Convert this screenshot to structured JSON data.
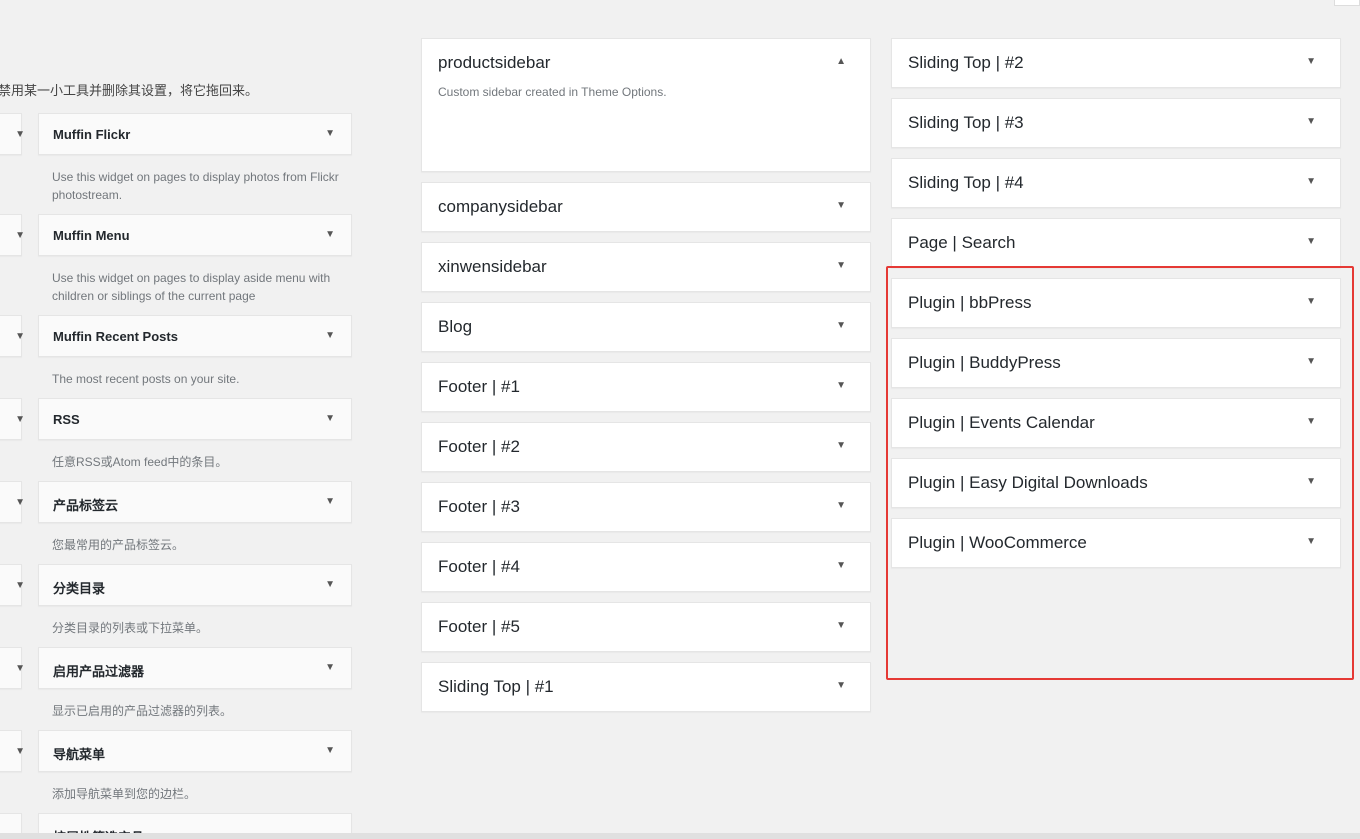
{
  "intro": "禁用某一小工具并删除其设置，将它拖回来。",
  "available_widgets": [
    {
      "title": "Muffin Flickr",
      "desc": "Use this widget on pages to display photos from Flickr photostream."
    },
    {
      "title": "Muffin Menu",
      "desc": "Use this widget on pages to display aside menu with children or siblings of the current page"
    },
    {
      "title": "Muffin Recent Posts",
      "desc": "The most recent posts on your site."
    },
    {
      "title": "RSS",
      "desc": "任意RSS或Atom feed中的条目。"
    },
    {
      "title": "产品标签云",
      "desc": "您最常用的产品标签云。"
    },
    {
      "title": "分类目录",
      "desc": "分类目录的列表或下拉菜单。"
    },
    {
      "title": "启用产品过滤器",
      "desc": "显示已启用的产品过滤器的列表。"
    },
    {
      "title": "导航菜单",
      "desc": "添加导航菜单到您的边栏。"
    },
    {
      "title": "按属性筛选产品",
      "desc": ""
    }
  ],
  "sidebars_middle": [
    {
      "title": "productsidebar",
      "desc": "Custom sidebar created in Theme Options.",
      "arrow": "▲"
    },
    {
      "title": "companysidebar",
      "arrow": "▼"
    },
    {
      "title": "xinwensidebar",
      "arrow": "▼"
    },
    {
      "title": "Blog",
      "arrow": "▼"
    },
    {
      "title": "Footer | #1",
      "arrow": "▼"
    },
    {
      "title": "Footer | #2",
      "arrow": "▼"
    },
    {
      "title": "Footer | #3",
      "arrow": "▼"
    },
    {
      "title": "Footer | #4",
      "arrow": "▼"
    },
    {
      "title": "Footer | #5",
      "arrow": "▼"
    },
    {
      "title": "Sliding Top | #1",
      "arrow": "▼"
    }
  ],
  "sidebars_right": [
    {
      "title": "Sliding Top | #2",
      "arrow": "▼"
    },
    {
      "title": "Sliding Top | #3",
      "arrow": "▼"
    },
    {
      "title": "Sliding Top | #4",
      "arrow": "▼"
    },
    {
      "title": "Page | Search",
      "arrow": "▼"
    },
    {
      "title": "Plugin | bbPress",
      "arrow": "▼"
    },
    {
      "title": "Plugin | BuddyPress",
      "arrow": "▼"
    },
    {
      "title": "Plugin | Events Calendar",
      "arrow": "▼"
    },
    {
      "title": "Plugin | Easy Digital Downloads",
      "arrow": "▼"
    },
    {
      "title": "Plugin | WooCommerce",
      "arrow": "▼"
    }
  ],
  "colors": {
    "highlight": "#e53935",
    "background": "#f1f1f1"
  }
}
